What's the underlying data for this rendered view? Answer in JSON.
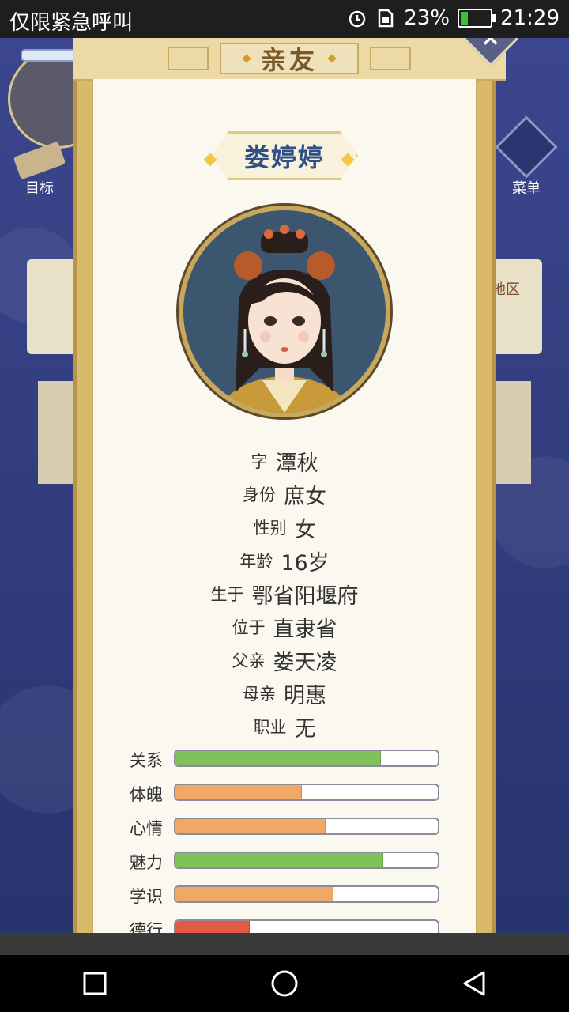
{
  "status_bar": {
    "carrier": "仅限紧急呼叫",
    "battery_percent": "23%",
    "time": "21:29",
    "icons": [
      "alarm-icon",
      "sim-icon",
      "battery-charging-icon"
    ]
  },
  "background": {
    "goal_label": "目标",
    "menu_label": "菜单",
    "region_label": "地区"
  },
  "panel": {
    "title": "亲友",
    "name": "娄婷婷"
  },
  "profile": [
    {
      "label": "字",
      "value": "潭秋"
    },
    {
      "label": "身份",
      "value": "庶女"
    },
    {
      "label": "性别",
      "value": "女"
    },
    {
      "label": "年龄",
      "value": "16岁"
    },
    {
      "label": "生于",
      "value": "鄂省阳堰府"
    },
    {
      "label": "位于",
      "value": "直隶省"
    },
    {
      "label": "父亲",
      "value": "娄天凌"
    },
    {
      "label": "母亲",
      "value": "明惠"
    },
    {
      "label": "职业",
      "value": "无"
    }
  ],
  "stats": [
    {
      "label": "关系",
      "fraction": 0.78,
      "color": "#7fc25a"
    },
    {
      "label": "体魄",
      "fraction": 0.48,
      "color": "#f0a865"
    },
    {
      "label": "心情",
      "fraction": 0.57,
      "color": "#f0a865"
    },
    {
      "label": "魅力",
      "fraction": 0.79,
      "color": "#7fc25a"
    },
    {
      "label": "学识",
      "fraction": 0.6,
      "color": "#f0a865"
    },
    {
      "label": "德行",
      "fraction": 0.28,
      "color": "#e45a45"
    }
  ]
}
